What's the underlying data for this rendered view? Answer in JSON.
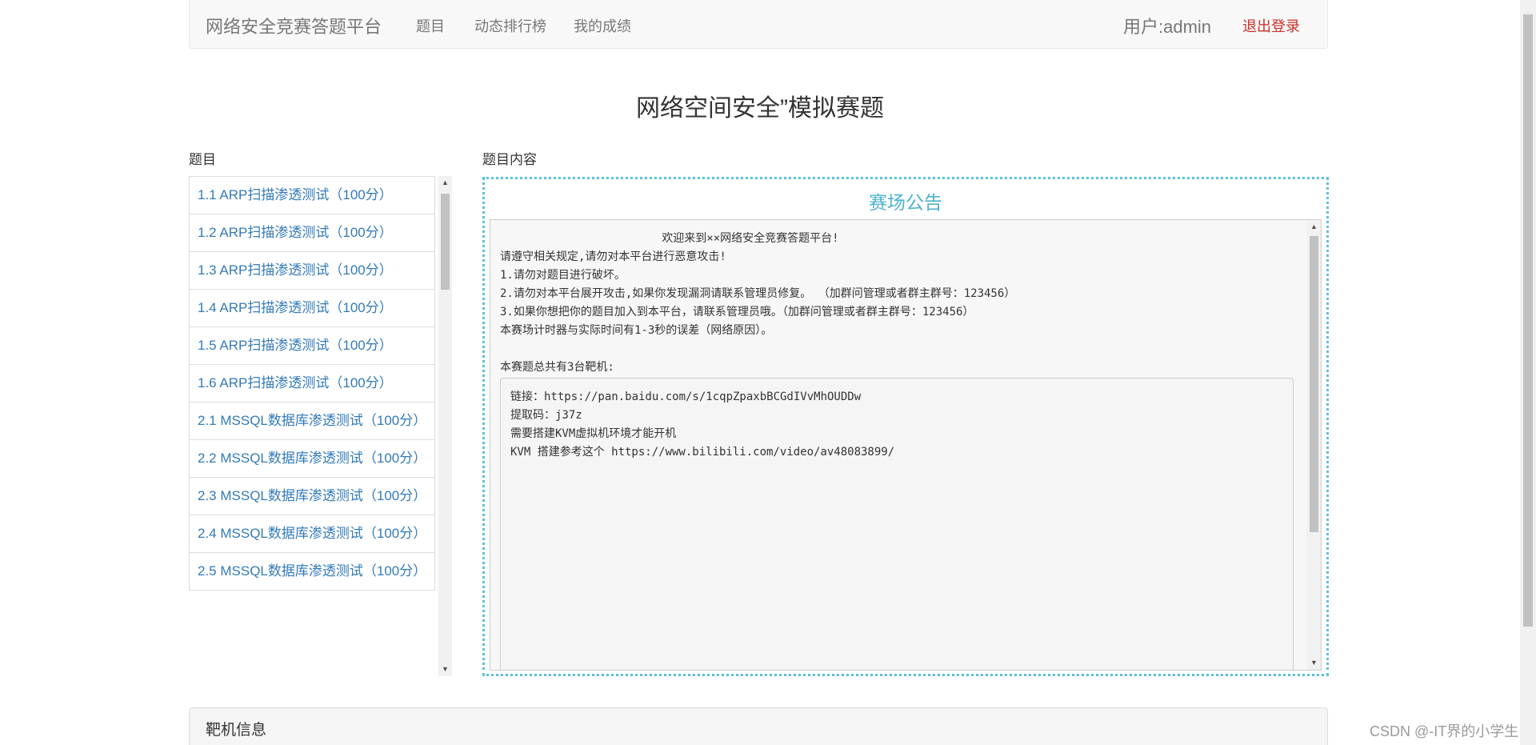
{
  "navbar": {
    "brand": "网络安全竞赛答题平台",
    "links": [
      "题目",
      "动态排行榜",
      "我的成绩"
    ],
    "user": "用户:admin",
    "logout": "退出登录"
  },
  "page_title": "网络空间安全”模拟赛题",
  "questions_label": "题目",
  "content_label": "题目内容",
  "questions": [
    "1.1 ARP扫描渗透测试（100分）",
    "1.2 ARP扫描渗透测试（100分）",
    "1.3 ARP扫描渗透测试（100分）",
    "1.4 ARP扫描渗透测试（100分）",
    "1.5 ARP扫描渗透测试（100分）",
    "1.6 ARP扫描渗透测试（100分）",
    "2.1 MSSQL数据库渗透测试（100分）",
    "2.2 MSSQL数据库渗透测试（100分）",
    "2.3 MSSQL数据库渗透测试（100分）",
    "2.4 MSSQL数据库渗透测试（100分）",
    "2.5 MSSQL数据库渗透测试（100分）"
  ],
  "notice": {
    "title": "赛场公告",
    "lines": [
      "                        欢迎来到××网络安全竞赛答题平台!",
      "请遵守相关规定,请勿对本平台进行恶意攻击!",
      "1.请勿对题目进行破坏。",
      "2.请勿对本平台展开攻击,如果你发现漏洞请联系管理员修复。 （加群问管理或者群主群号：123456）",
      "3.如果你想把你的题目加入到本平台，请联系管理员哦。（加群问管理或者群主群号：123456）",
      "本赛场计时器与实际时间有1-3秒的误差（网络原因）。",
      "",
      "本赛题总共有3台靶机:"
    ],
    "inner_lines": [
      "链接：https://pan.baidu.com/s/1cqpZpaxbBCGdIVvMhOUDDw",
      "提取码：j37z",
      "需要搭建KVM虚拟机环境才能开机",
      "KVM 搭建参考这个 https://www.bilibili.com/video/av48083899/"
    ]
  },
  "target_panel": {
    "title": "靶机信息"
  },
  "watermark": "CSDN @-IT界的小学生",
  "icons": {
    "scroll_up": "triangle-up-icon",
    "scroll_down": "triangle-down-icon"
  },
  "colors": {
    "link": "#337ab7",
    "logout": "#c9302c",
    "notice_accent": "#5bc0de"
  }
}
